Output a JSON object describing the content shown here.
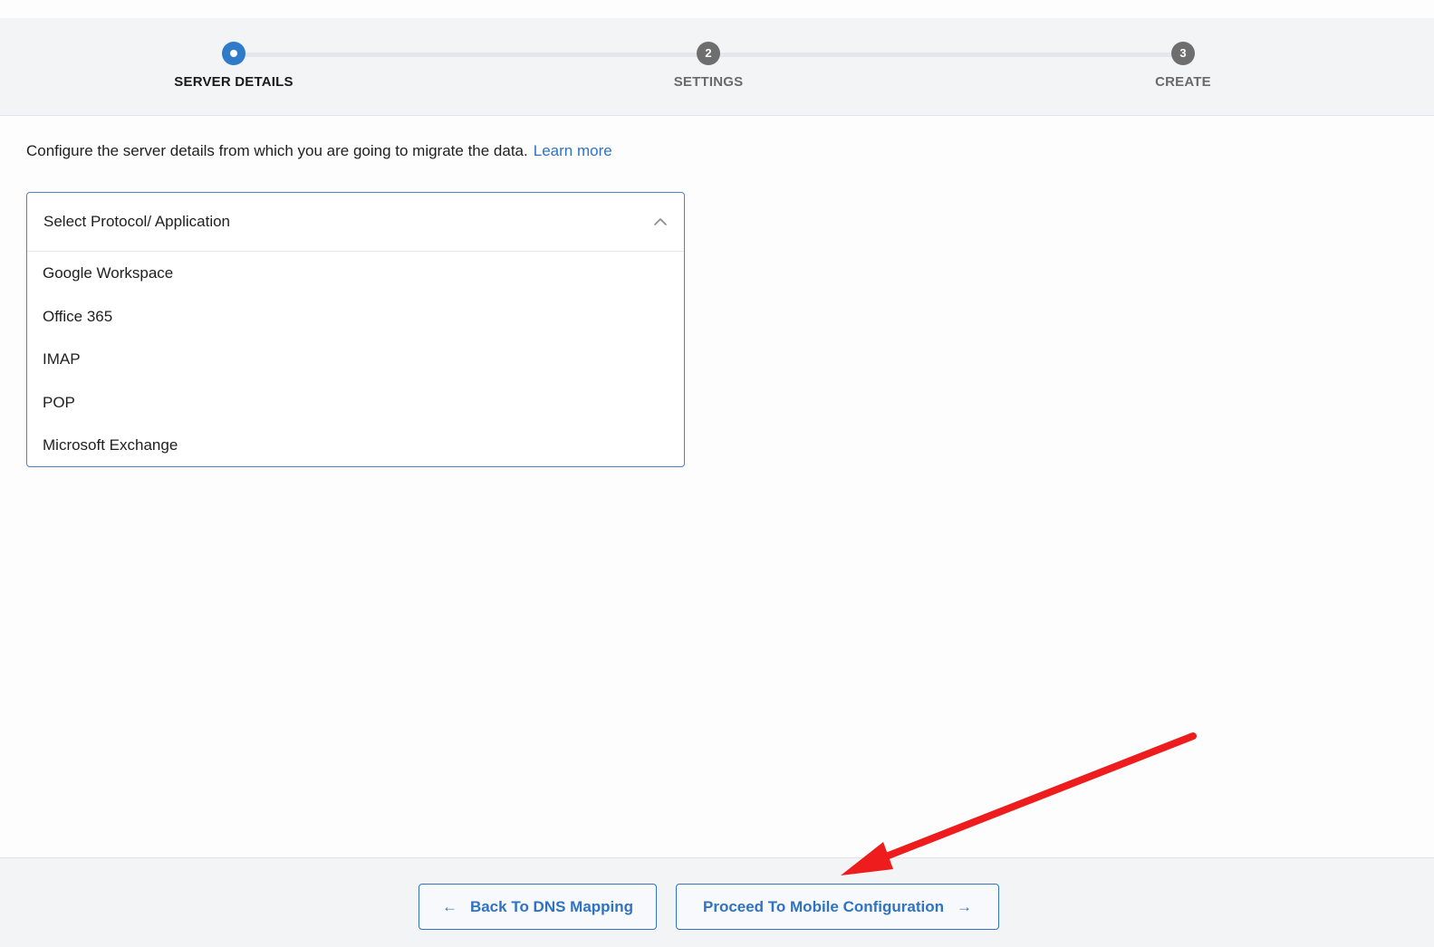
{
  "stepper": {
    "steps": [
      {
        "number": "",
        "label": "SERVER DETAILS",
        "state": "active"
      },
      {
        "number": "2",
        "label": "SETTINGS",
        "state": "pending"
      },
      {
        "number": "3",
        "label": "CREATE",
        "state": "pending"
      }
    ]
  },
  "intro": {
    "text": "Configure the server details from which you are going to migrate the data.",
    "learn_more": "Learn more"
  },
  "dropdown": {
    "placeholder": "Select Protocol/ Application",
    "state": "expanded",
    "options": [
      "Google Workspace",
      "Office 365",
      "IMAP",
      "POP",
      "Microsoft Exchange"
    ]
  },
  "footer": {
    "back_label": "Back To DNS Mapping",
    "proceed_label": "Proceed To Mobile Configuration"
  },
  "icons": {
    "back": "arrow-left-icon",
    "proceed": "arrow-right-icon",
    "dropdown": "chevron-up-icon"
  },
  "colors": {
    "accent": "#2f73c2",
    "step_active": "#2f7ac9",
    "step_pending": "#6e6e6e",
    "header_bg": "#f3f4f6",
    "annotation_arrow": "#ee1c1c"
  }
}
